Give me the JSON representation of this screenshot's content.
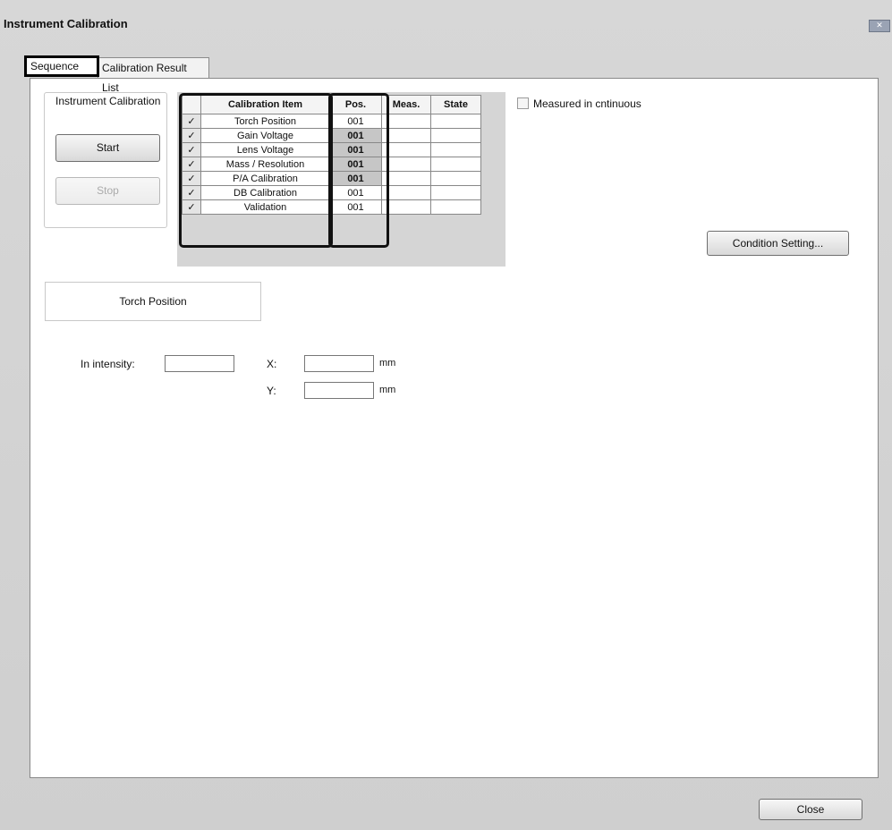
{
  "window": {
    "title": "Instrument Calibration"
  },
  "tabs": [
    {
      "label": "Sequence",
      "active": true
    },
    {
      "label": "Calibration Result List",
      "active": false
    }
  ],
  "control_group": {
    "title": "Instrument Calibration",
    "start_label": "Start",
    "stop_label": "Stop"
  },
  "grid": {
    "columns": [
      "",
      "Calibration Item",
      "Pos.",
      "Meas.",
      "State"
    ],
    "rows": [
      {
        "checked": "✓",
        "item": "Torch Position",
        "pos": "001",
        "meas": "",
        "state": ""
      },
      {
        "checked": "✓",
        "item": "Gain Voltage",
        "pos": "001",
        "meas": "",
        "state": ""
      },
      {
        "checked": "✓",
        "item": "Lens Voltage",
        "pos": "001",
        "meas": "",
        "state": ""
      },
      {
        "checked": "✓",
        "item": "Mass / Resolution",
        "pos": "001",
        "meas": "",
        "state": ""
      },
      {
        "checked": "✓",
        "item": "P/A Calibration",
        "pos": "001",
        "meas": "",
        "state": ""
      },
      {
        "checked": "✓",
        "item": "DB Calibration",
        "pos": "001",
        "meas": "",
        "state": ""
      },
      {
        "checked": "✓",
        "item": "Validation",
        "pos": "001",
        "meas": "",
        "state": ""
      }
    ]
  },
  "continuous": {
    "label": "Measured in cntinuous",
    "checked": false
  },
  "condition_button": "Condition Setting...",
  "torch_panel": {
    "title": "Torch Position",
    "intensity_label": "In intensity:",
    "intensity_value": "",
    "x_label": "X:",
    "x_value": "",
    "x_unit": "mm",
    "y_label": "Y:",
    "y_value": "",
    "y_unit": "mm"
  },
  "close_button": "Close"
}
